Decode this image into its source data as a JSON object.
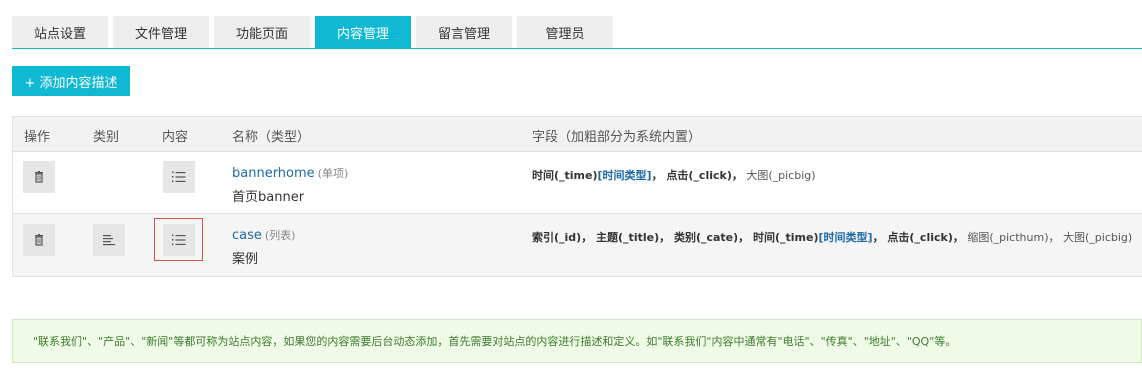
{
  "tabs": [
    {
      "label": "站点设置"
    },
    {
      "label": "文件管理"
    },
    {
      "label": "功能页面"
    },
    {
      "label": "内容管理"
    },
    {
      "label": "留言管理"
    },
    {
      "label": "管理员"
    }
  ],
  "active_tab": "内容管理",
  "add_button": "+ 添加内容描述",
  "table": {
    "headers": {
      "op": "操作",
      "category": "类别",
      "content": "内容",
      "name": "名称（类型）",
      "fields": "字段（加粗部分为系统内置）"
    },
    "rows": [
      {
        "name": "bannerhome",
        "type": "(单项)",
        "title": "首页banner",
        "fields": [
          {
            "text": "时间(_time)",
            "bold": true
          },
          {
            "text": "[时间类型]",
            "sys": true
          },
          {
            "text": "，",
            "bold": true
          },
          {
            "text": " 点击(_click)",
            "bold": true
          },
          {
            "text": "，",
            "bold": true
          },
          {
            "text": " 大图(_picbig)",
            "plain": true
          }
        ]
      },
      {
        "name": "case",
        "type": "(列表)",
        "title": "案例",
        "fields": [
          {
            "text": "索引(_id)，",
            "bold": true
          },
          {
            "text": " 主题(_title)，",
            "bold": true
          },
          {
            "text": " 类别(_cate)，",
            "bold": true
          },
          {
            "text": " 时间(_time)",
            "bold": true
          },
          {
            "text": "[时间类型]",
            "sys": true
          },
          {
            "text": "，",
            "bold": true
          },
          {
            "text": "  点击(_click)，",
            "bold": true
          },
          {
            "text": " 缩图(_picthum)，",
            "plain": true
          },
          {
            "text": " 大图(_picbig)",
            "plain": true
          }
        ]
      }
    ]
  },
  "notice": "\"联系我们\"、\"产品\"、\"新闻\"等都可称为站点内容，如果您的内容需要后台动态添加，首先需要对站点的内容进行描述和定义。如\"联系我们\"内容中通常有\"电话\"、\"传真\"、\"地址\"、\"QQ\"等。",
  "colors": {
    "accent": "#0fb9d4",
    "link": "#1c6aa6",
    "notice_bg": "#f0fbe7",
    "highlight": "#d9534f"
  }
}
